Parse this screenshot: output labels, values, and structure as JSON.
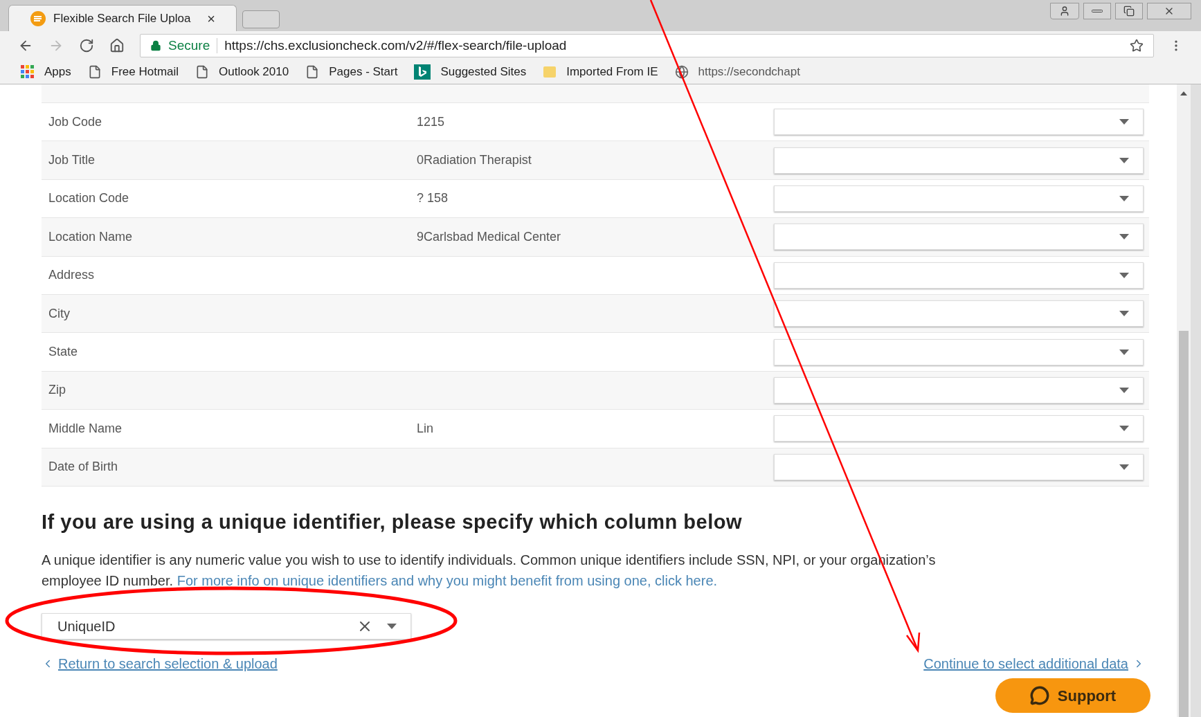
{
  "browser": {
    "tab_title": "Flexible Search File Uploa",
    "close_glyph": "×",
    "secure_label": "Secure",
    "url": "https://chs.exclusioncheck.com/v2/#/flex-search/file-upload",
    "bookmarks": [
      {
        "kind": "apps",
        "label": "Apps"
      },
      {
        "kind": "page",
        "label": "Free Hotmail"
      },
      {
        "kind": "page",
        "label": "Outlook 2010"
      },
      {
        "kind": "page",
        "label": "Pages - Start"
      },
      {
        "kind": "bing",
        "label": "Suggested Sites"
      },
      {
        "kind": "folder",
        "label": "Imported From IE"
      },
      {
        "kind": "globe",
        "label": "https://secondchapt"
      }
    ]
  },
  "mapping_rows": [
    {
      "label": "Job Code",
      "value": "1215"
    },
    {
      "label": "Job Title",
      "value": "0Radiation Therapist"
    },
    {
      "label": "Location Code",
      "value": "? 158"
    },
    {
      "label": "Location Name",
      "value": "9Carlsbad Medical Center"
    },
    {
      "label": "Address",
      "value": ""
    },
    {
      "label": "City",
      "value": ""
    },
    {
      "label": "State",
      "value": ""
    },
    {
      "label": "Zip",
      "value": ""
    },
    {
      "label": "Middle Name",
      "value": "Lin"
    },
    {
      "label": "Date of Birth",
      "value": ""
    }
  ],
  "unique_section": {
    "heading": "If you are using a unique identifier, please specify which column below",
    "description": "A unique identifier is any numeric value you wish to use to identify individuals. Common unique identifiers include SSN, NPI, or your organization’s employee ID number.",
    "info_link": "For more info on unique identifiers and why you might benefit from using one, click here.",
    "select_value": "UniqueID"
  },
  "nav": {
    "back_link": "Return to search selection & upload",
    "continue_link": "Continue to select additional data"
  },
  "support_button": "Support"
}
